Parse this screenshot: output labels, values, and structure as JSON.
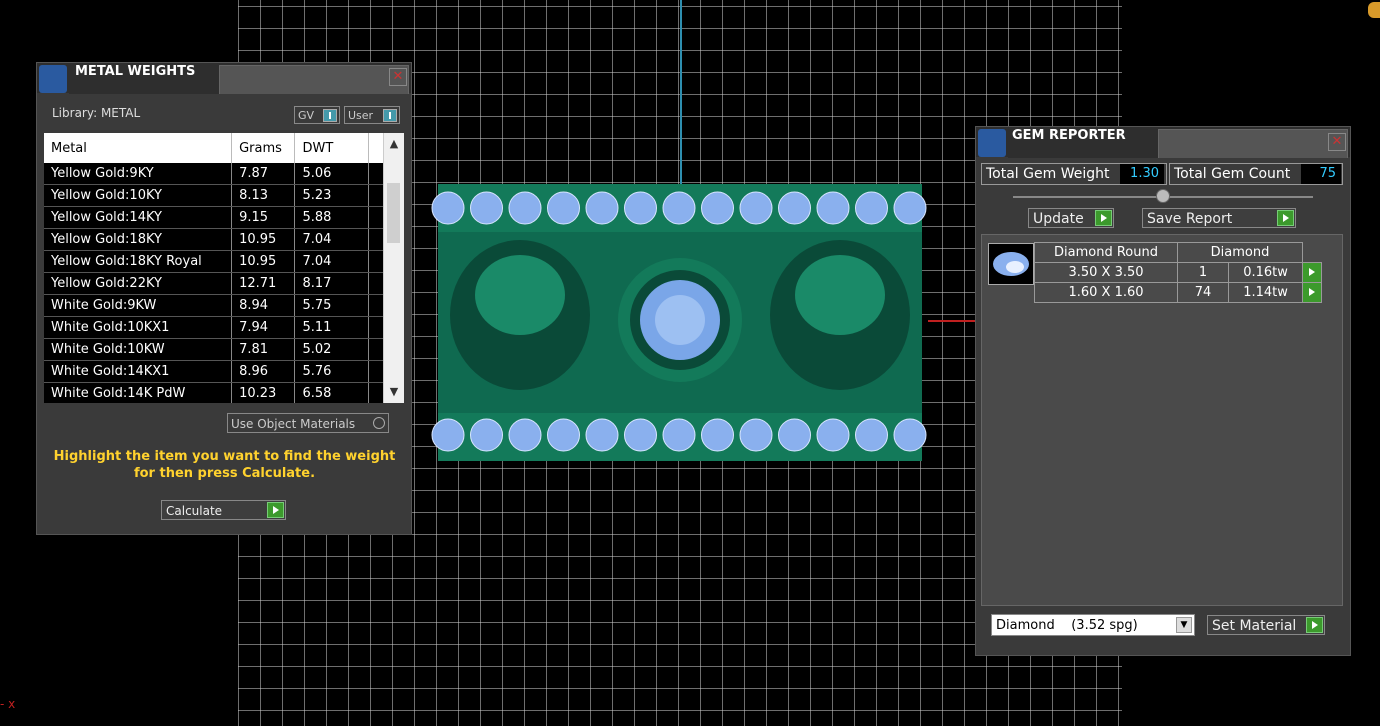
{
  "metal_weights": {
    "title": "METAL WEIGHTS",
    "library_label": "Library: METAL",
    "toggles": {
      "gv": "GV",
      "user": "User"
    },
    "columns": [
      "Metal",
      "Grams",
      "DWT"
    ],
    "rows": [
      [
        "Yellow Gold:9KY",
        "7.87",
        "5.06"
      ],
      [
        "Yellow Gold:10KY",
        "8.13",
        "5.23"
      ],
      [
        "Yellow Gold:14KY",
        "9.15",
        "5.88"
      ],
      [
        "Yellow Gold:18KY",
        "10.95",
        "7.04"
      ],
      [
        "Yellow Gold:18KY Royal",
        "10.95",
        "7.04"
      ],
      [
        "Yellow Gold:22KY",
        "12.71",
        "8.17"
      ],
      [
        "White Gold:9KW",
        "8.94",
        "5.75"
      ],
      [
        "White Gold:10KX1",
        "7.94",
        "5.11"
      ],
      [
        "White Gold:10KW",
        "7.81",
        "5.02"
      ],
      [
        "White Gold:14KX1",
        "8.96",
        "5.76"
      ],
      [
        "White Gold:14K PdW",
        "10.23",
        "6.58"
      ]
    ],
    "use_object_materials": "Use Object Materials",
    "instruction": "Highlight the item you want to find the weight for then press Calculate.",
    "calculate_label": "Calculate"
  },
  "gem_reporter": {
    "title": "GEM REPORTER",
    "total_weight_label": "Total Gem Weight",
    "total_weight_value": "1.30",
    "total_count_label": "Total Gem Count",
    "total_count_value": "75",
    "update_label": "Update",
    "save_report_label": "Save Report",
    "header": [
      "Diamond Round",
      "Diamond"
    ],
    "rows": [
      {
        "size": "3.50 X 3.50",
        "count": "1",
        "weight": "0.16tw"
      },
      {
        "size": "1.60 X 1.60",
        "count": "74",
        "weight": "1.14tw"
      }
    ],
    "material_select": "Diamond    (3.52 spg)",
    "set_material_label": "Set Material"
  },
  "status": {
    "corner_marker": "- x"
  }
}
